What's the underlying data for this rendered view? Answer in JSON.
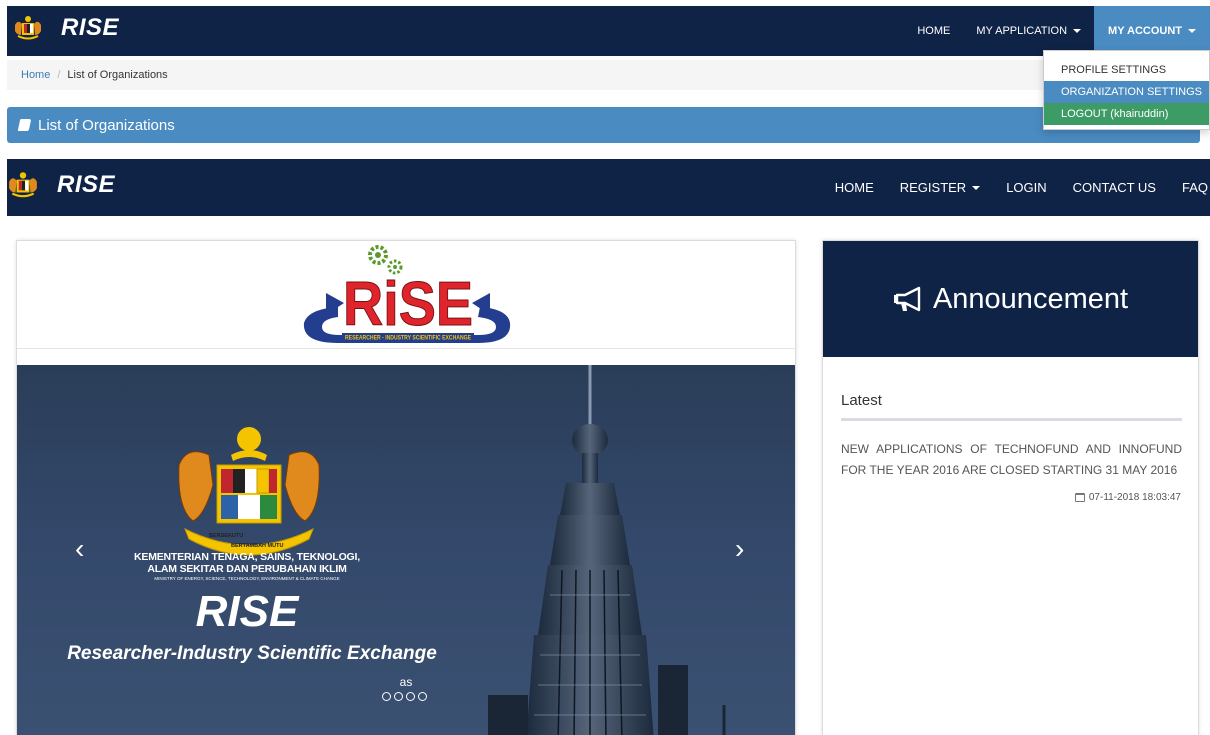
{
  "top_nav": {
    "brand": "RISE",
    "links": [
      "HOME",
      "MY APPLICATION",
      "MY ACCOUNT"
    ]
  },
  "breadcrumb": {
    "home": "Home",
    "current": "List of Organizations"
  },
  "panel": {
    "title": "List of Organizations"
  },
  "account_menu": {
    "items": [
      "PROFILE SETTINGS",
      "ORGANIZATION SETTINGS",
      "LOGOUT (khairuddin)"
    ],
    "highlighted": "ORGANIZATION SETTINGS"
  },
  "public_nav": {
    "brand": "RISE",
    "links": [
      "HOME",
      "REGISTER",
      "LOGIN",
      "CONTACT US",
      "FAQ"
    ]
  },
  "logo": {
    "name": "RISE",
    "tagline": "RESEARCHER - INDUSTRY SCIENTIFIC EXCHANGE"
  },
  "slide": {
    "crest_motto_1": "BERSEKUTU",
    "crest_motto_2": "BERTAMBAH MUTU",
    "ministry_line_1": "KEMENTERIAN TENAGA, SAINS, TEKNOLOGI,",
    "ministry_line_2": "ALAM SEKITAR DAN PERUBAHAN IKLIM",
    "ministry_line_3": "MINISTRY OF ENERGY, SCIENCE, TECHNOLOGY, ENVIRONMENT & CLIMATE CHANGE",
    "title": "RISE",
    "subtitle": "Researcher-Industry Scientific Exchange",
    "caption": "as",
    "indicator_count": 4,
    "prev": "‹",
    "next": "›"
  },
  "announcement": {
    "title": "Announcement",
    "latest_label": "Latest",
    "news": "NEW APPLICATIONS OF TECHNOFUND AND INNOFUND FOR THE YEAR 2016 ARE CLOSED STARTING 31 MAY 2016",
    "date": "07-11-2018 18:03:47"
  },
  "colors": {
    "navbar": "#0f2347",
    "accent_blue": "#4a8bc2",
    "logout_green": "#3d9b65",
    "logo_red": "#e0242c"
  }
}
